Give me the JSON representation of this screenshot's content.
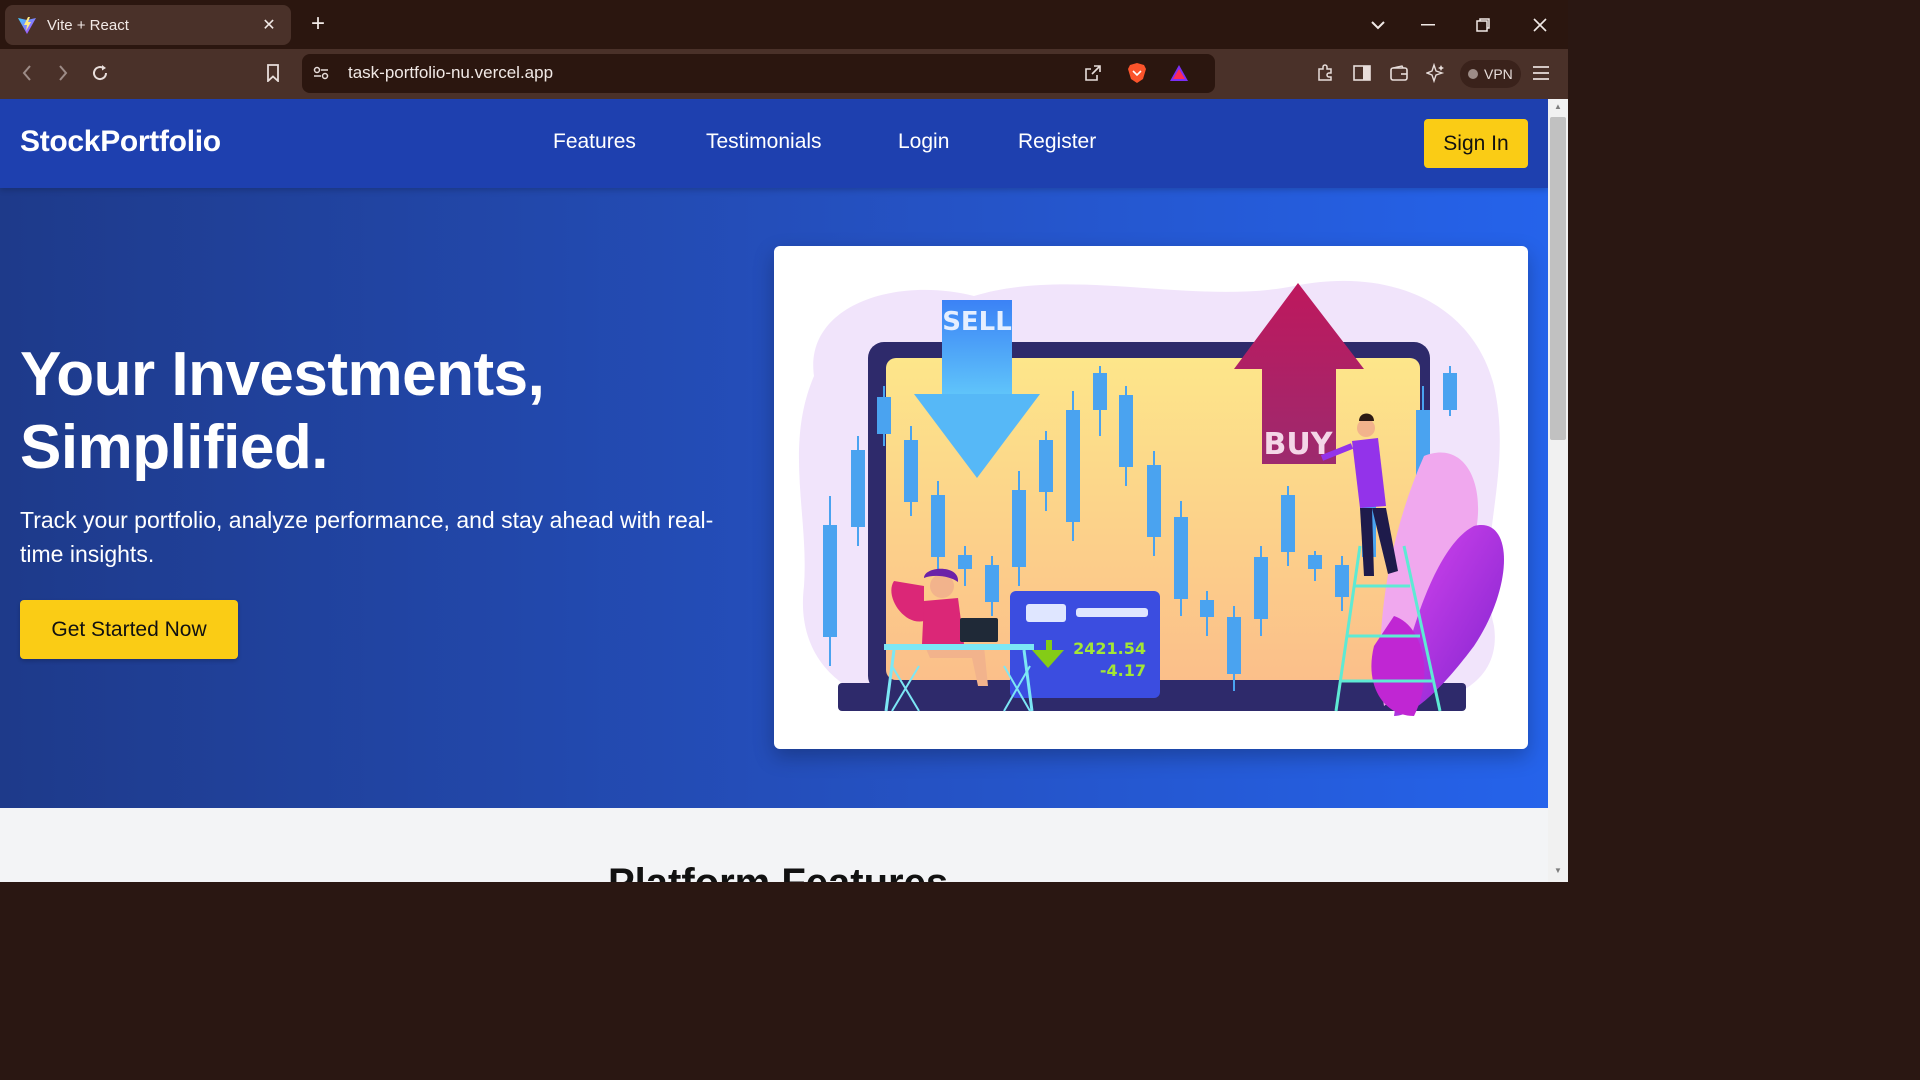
{
  "browser": {
    "tab_title": "Vite + React",
    "url": "task-portfolio-nu.vercel.app",
    "vpn_label": "VPN"
  },
  "navbar": {
    "brand": "StockPortfolio",
    "links": [
      "Features",
      "Testimonials",
      "Login",
      "Register"
    ],
    "signin_label": "Sign In"
  },
  "hero": {
    "headline_line1": "Your Investments,",
    "headline_line2": "Simplified.",
    "subtext": "Track your portfolio, analyze performance, and stay ahead with real-time insights.",
    "cta_label": "Get Started Now",
    "illustration": {
      "sell_label": "SELL",
      "buy_label": "BUY",
      "price": "2421.54",
      "change": "-4.17"
    }
  },
  "features_section": {
    "heading_peek": "Platform Features"
  },
  "colors": {
    "navbar": "#1e40af",
    "accent_yellow": "#facc15",
    "hero_start": "#1e3a8a",
    "hero_end": "#2563eb"
  }
}
